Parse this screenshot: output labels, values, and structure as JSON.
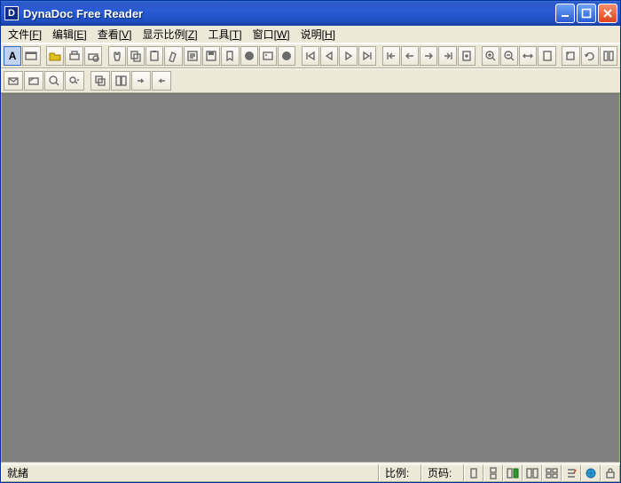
{
  "titlebar": {
    "title": "DynaDoc Free Reader",
    "app_icon_letter": "D"
  },
  "menu": {
    "file": {
      "label": "文件",
      "accel": "F"
    },
    "edit": {
      "label": "编辑",
      "accel": "E"
    },
    "view": {
      "label": "查看",
      "accel": "V"
    },
    "zoom": {
      "label": "显示比例",
      "accel": "Z"
    },
    "tools": {
      "label": "工具",
      "accel": "T"
    },
    "window": {
      "label": "窗口",
      "accel": "W"
    },
    "help": {
      "label": "说明",
      "accel": "H"
    }
  },
  "status": {
    "ready": "就緒",
    "zoom_label": "比例:",
    "page_label": "页码:"
  },
  "icons": {
    "text_mode": "A",
    "arrow_bidi": "⇔"
  }
}
